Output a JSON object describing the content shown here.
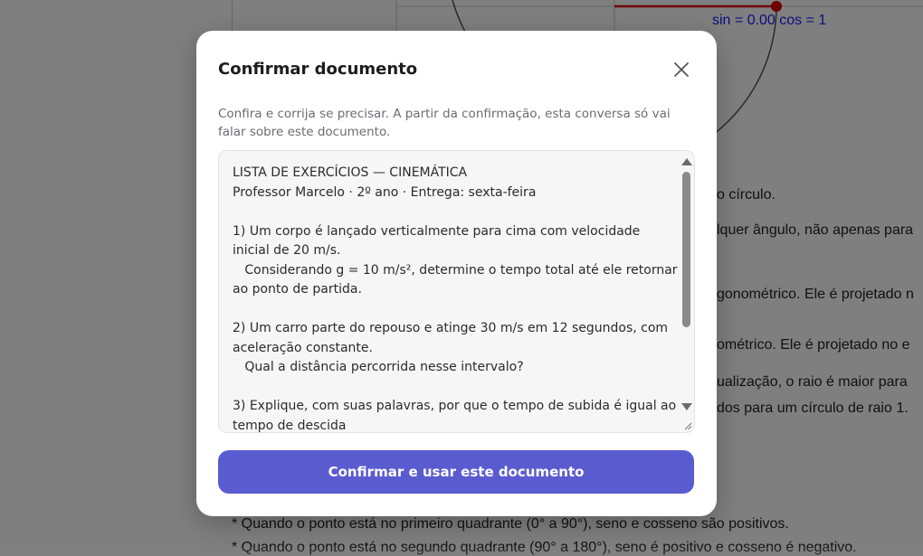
{
  "background": {
    "readout": "sin = 0.00  cos = 1",
    "paragraph_fragments": [
      "o círculo.",
      "lquer ângulo, não apenas para",
      "gonométrico. Ele é projetado n",
      "ométrico. Ele é projetado no e",
      "ualização, o raio é maior para",
      "dos para um círculo de raio 1.",
      "* Quando o ponto está no primeiro quadrante (0° a 90°), seno e cosseno são positivos.",
      "* Quando o ponto está no segundo quadrante (90° a 180°), seno é positivo e cosseno é negativo."
    ]
  },
  "modal": {
    "title": "Confirmar documento",
    "description": "Confira e corrija se precisar. A partir da confirmação, esta conversa só vai falar sobre este documento.",
    "document_text": "LISTA DE EXERCÍCIOS — CINEMÁTICA\nProfessor Marcelo · 2º ano · Entrega: sexta-feira\n\n1) Um corpo é lançado verticalmente para cima com velocidade inicial de 20 m/s.\n   Considerando g = 10 m/s², determine o tempo total até ele retornar ao ponto de partida.\n\n2) Um carro parte do repouso e atinge 30 m/s em 12 segundos, com aceleração constante.\n   Qual a distância percorrida nesse intervalo?\n\n3) Explique, com suas palavras, por que o tempo de subida é igual ao tempo de descida",
    "confirm_label": "Confirmar e usar este documento"
  },
  "colors": {
    "accent": "#5b5bd0",
    "overlay": "rgba(0,0,0,0.5)",
    "readout": "#1a1aff",
    "radius_line": "#dd0000"
  },
  "icons": {
    "close": "close-icon",
    "scroll_up": "scroll-up-arrow-icon",
    "scroll_down": "scroll-down-arrow-icon",
    "resize": "resize-grip-icon"
  }
}
